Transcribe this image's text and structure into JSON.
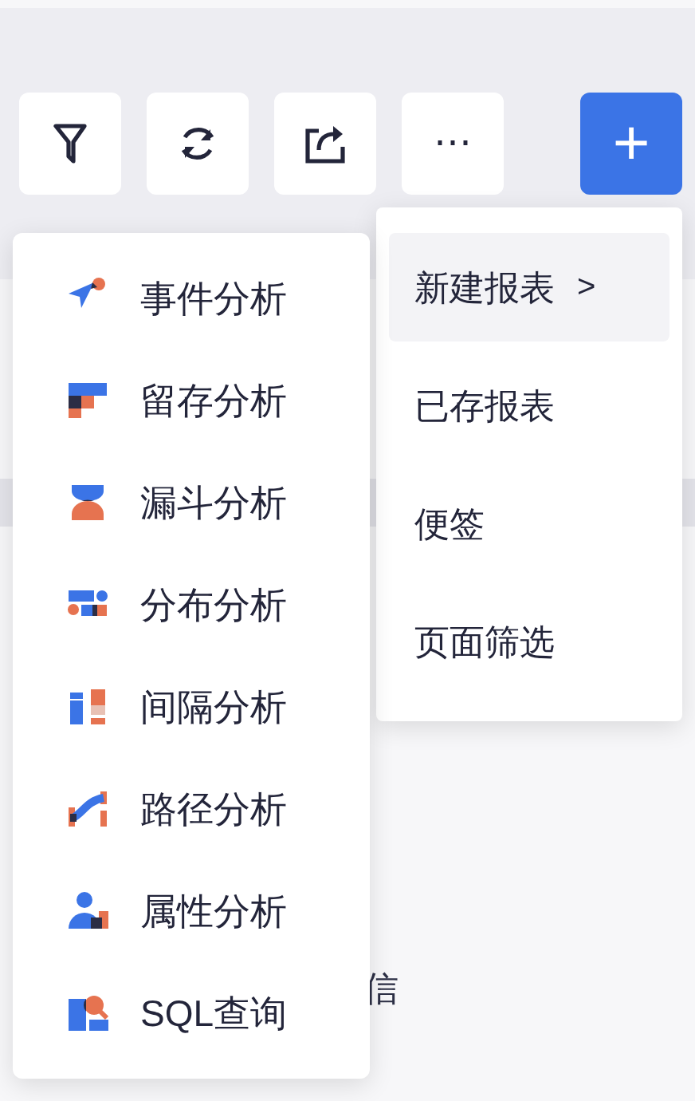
{
  "toolbar": {
    "buttons": [
      {
        "kind": "filter"
      },
      {
        "kind": "refresh"
      },
      {
        "kind": "share"
      },
      {
        "kind": "more",
        "label": "⋯"
      },
      {
        "kind": "add",
        "label": "+"
      }
    ]
  },
  "add_menu": {
    "items": [
      {
        "label": "新建报表",
        "arrow": ">",
        "selected": true
      },
      {
        "label": "已存报表",
        "selected": false
      },
      {
        "label": "便签",
        "selected": false
      },
      {
        "label": "页面筛选",
        "selected": false
      }
    ]
  },
  "report_submenu": {
    "items": [
      {
        "label": "事件分析"
      },
      {
        "label": "留存分析"
      },
      {
        "label": "漏斗分析"
      },
      {
        "label": "分布分析"
      },
      {
        "label": "间隔分析"
      },
      {
        "label": "路径分析"
      },
      {
        "label": "属性分析"
      },
      {
        "label": "SQL查询"
      }
    ]
  },
  "background_text": "信"
}
